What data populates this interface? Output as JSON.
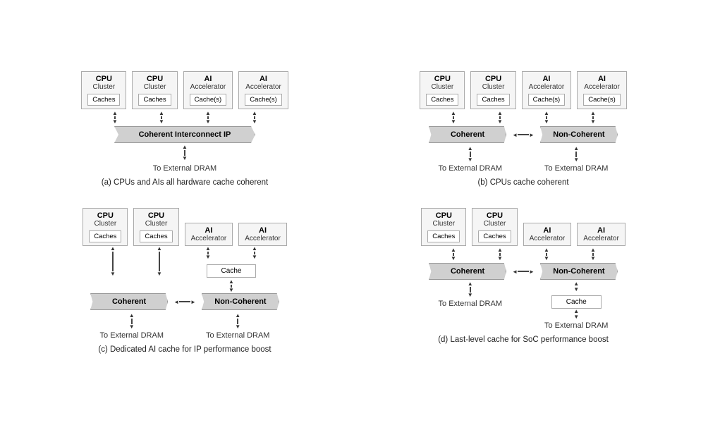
{
  "diagrams": [
    {
      "id": "a",
      "caption": "(a) CPUs and AIs all hardware cache coherent",
      "nodes": [
        {
          "title": "CPU",
          "sub": "Cluster",
          "cache": "Caches"
        },
        {
          "title": "CPU",
          "sub": "Cluster",
          "cache": "Caches"
        },
        {
          "title": "AI",
          "sub": "Accelerator",
          "cache": "Cache(s)"
        },
        {
          "title": "AI",
          "sub": "Accelerator",
          "cache": "Cache(s)"
        }
      ],
      "interconnect": {
        "type": "single",
        "label": "Coherent Interconnect IP"
      },
      "dram": [
        {
          "label": "To External DRAM"
        }
      ]
    },
    {
      "id": "b",
      "caption": "(b) CPUs cache coherent",
      "nodes": [
        {
          "title": "CPU",
          "sub": "Cluster",
          "cache": "Caches"
        },
        {
          "title": "CPU",
          "sub": "Cluster",
          "cache": "Caches"
        },
        {
          "title": "AI",
          "sub": "Accelerator",
          "cache": "Cache(s)"
        },
        {
          "title": "AI",
          "sub": "Accelerator",
          "cache": "Cache(s)"
        }
      ],
      "interconnect": {
        "type": "double",
        "left": "Coherent",
        "right": "Non-Coherent"
      },
      "dram": [
        {
          "label": "To External DRAM"
        },
        {
          "label": "To External DRAM"
        }
      ]
    },
    {
      "id": "c",
      "caption": "(c) Dedicated AI cache for IP performance boost",
      "nodes": [
        {
          "title": "CPU",
          "sub": "Cluster",
          "cache": "Caches"
        },
        {
          "title": "CPU",
          "sub": "Cluster",
          "cache": "Caches"
        },
        {
          "title": "AI",
          "sub": "Accelerator",
          "cache": null
        },
        {
          "title": "AI",
          "sub": "Accelerator",
          "cache": null
        }
      ],
      "ai_cache": "Cache",
      "interconnect": {
        "type": "double",
        "left": "Coherent",
        "right": "Non-Coherent"
      },
      "dram": [
        {
          "label": "To External DRAM"
        },
        {
          "label": "To External DRAM"
        }
      ]
    },
    {
      "id": "d",
      "caption": "(d) Last-level cache for SoC performance boost",
      "nodes": [
        {
          "title": "CPU",
          "sub": "Cluster",
          "cache": "Caches"
        },
        {
          "title": "CPU",
          "sub": "Cluster",
          "cache": "Caches"
        },
        {
          "title": "AI",
          "sub": "Accelerator",
          "cache": null
        },
        {
          "title": "AI",
          "sub": "Accelerator",
          "cache": null
        }
      ],
      "llc_cache": "Cache",
      "interconnect": {
        "type": "double",
        "left": "Coherent",
        "right": "Non-Coherent"
      },
      "dram": [
        {
          "label": "To External DRAM"
        },
        {
          "label": "To External DRAM"
        }
      ]
    }
  ]
}
